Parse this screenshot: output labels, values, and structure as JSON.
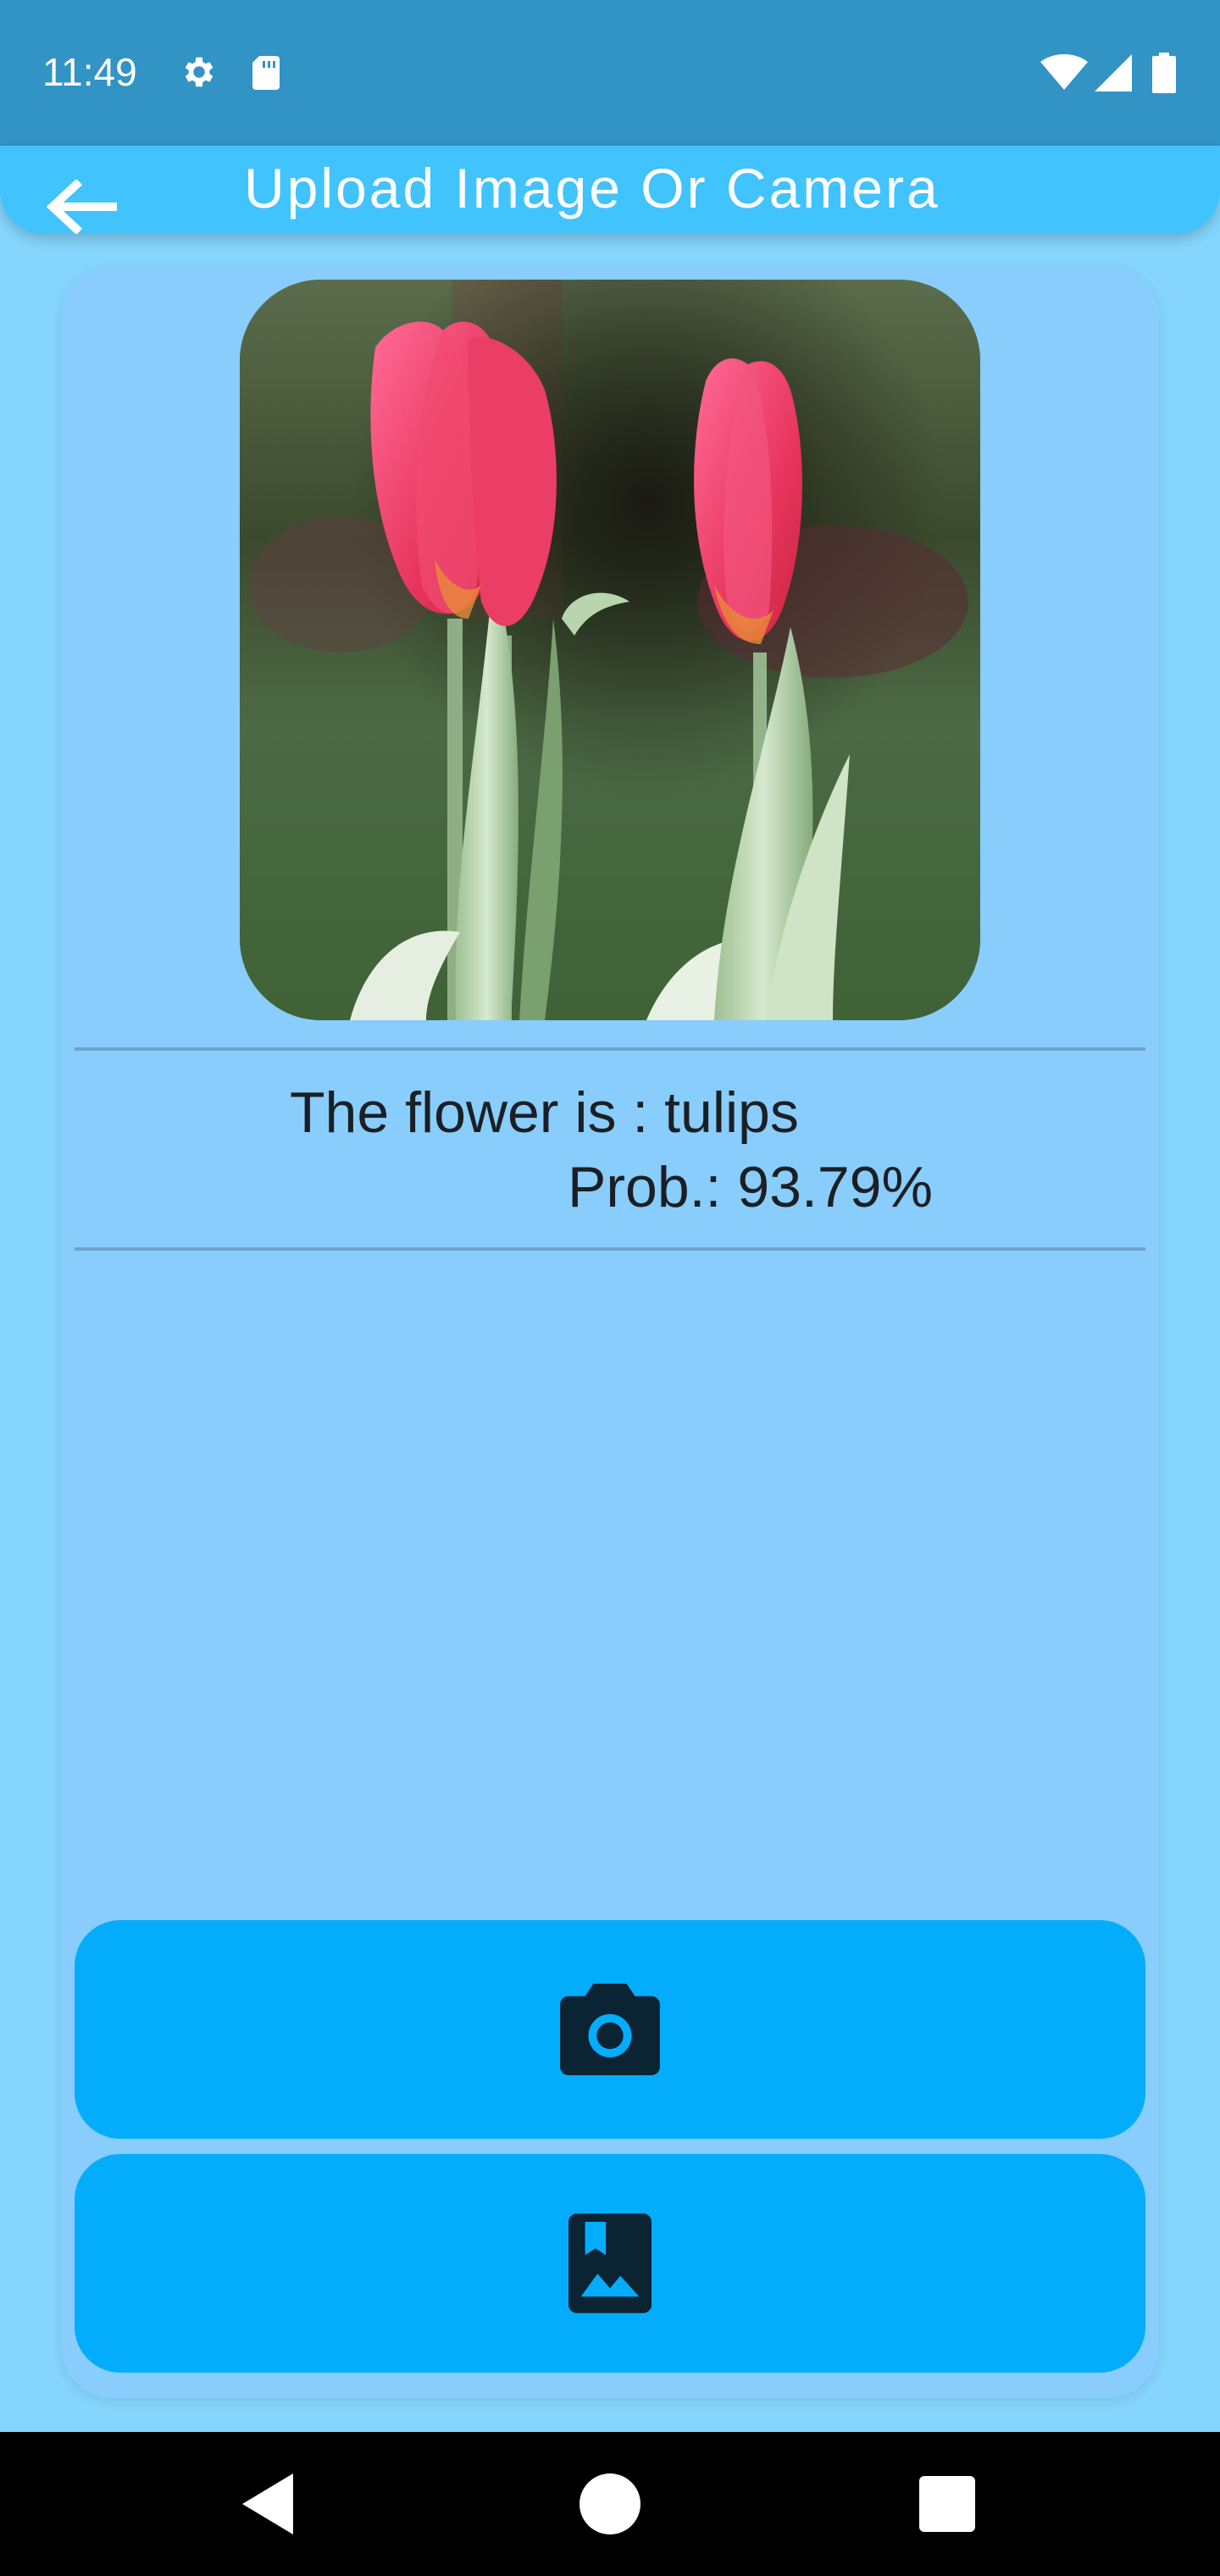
{
  "status_bar": {
    "time": "11:49",
    "icons": [
      "gear-icon",
      "sd-card-icon",
      "wifi-icon",
      "cell-signal-icon",
      "battery-icon"
    ]
  },
  "app_bar": {
    "title": "Upload Image Or Camera",
    "back_icon": "arrow-left-icon"
  },
  "result": {
    "image_subject": "tulips",
    "flower_line": "The flower is : tulips",
    "prob_line": "Prob.: 93.79%"
  },
  "actions": {
    "camera_icon": "camera-icon",
    "gallery_icon": "photo-album-icon"
  },
  "nav_bar": {
    "icons": [
      "back-triangle-icon",
      "home-circle-icon",
      "recents-square-icon"
    ]
  },
  "colors": {
    "status_bar": "#3293c5",
    "app_bar": "#41c3fd",
    "background": "#84d4fb",
    "card": "#88cdfc",
    "button": "#03adfc",
    "icon_dark": "#0a2434"
  }
}
